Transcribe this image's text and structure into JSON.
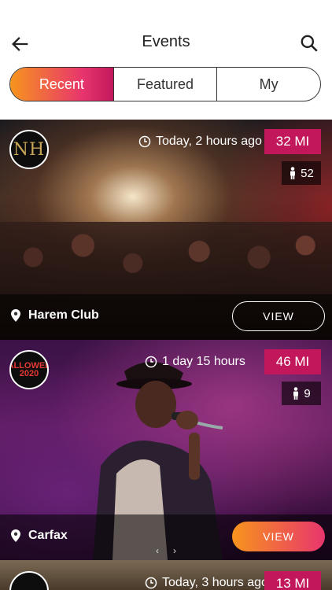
{
  "header": {
    "title": "Events",
    "back_icon": "back-arrow-icon",
    "search_icon": "search-icon"
  },
  "tabs": [
    {
      "label": "Recent",
      "active": true
    },
    {
      "label": "Featured",
      "active": false
    },
    {
      "label": "My",
      "active": false
    }
  ],
  "events": [
    {
      "logo": "NH",
      "time": "Today, 2 hours ago",
      "distance": "32 MI",
      "attendees": "52",
      "venue": "Harem Club",
      "action": "VIEW"
    },
    {
      "logo_top": "HALLOWEEN",
      "logo_bottom": "2020",
      "time": "1 day 15 hours",
      "distance": "46 MI",
      "attendees": "9",
      "venue": "Carfax",
      "action": "VIEW"
    },
    {
      "time": "Today, 3 hours ago",
      "distance": "13 MI"
    }
  ],
  "carousel": {
    "prev": "‹",
    "next": "›"
  },
  "colors": {
    "accent": "#c2185b",
    "gradient_start": "#f7941d",
    "gradient_end": "#e8356d"
  }
}
